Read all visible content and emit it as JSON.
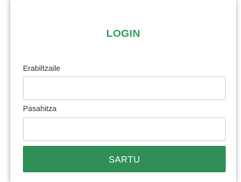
{
  "login": {
    "title": "LOGIN",
    "username_label": "Erabiltzaile",
    "username_value": "",
    "password_label": "Pasahitza",
    "password_value": "",
    "submit_label": "SARTU"
  },
  "colors": {
    "accent": "#2e9a55",
    "button": "#2f8f57"
  }
}
